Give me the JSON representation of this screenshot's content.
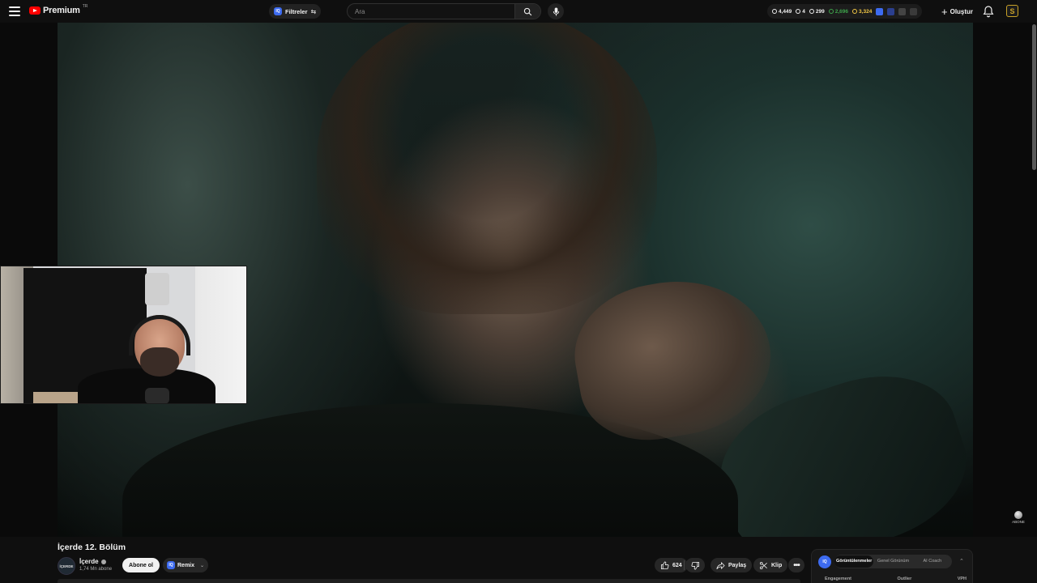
{
  "header": {
    "logo_text": "Premium",
    "logo_region": "TR",
    "filters_label": "Filtreler",
    "filters_badge": "IQ",
    "search_placeholder": "Ara",
    "stats": [
      {
        "icon": "clock-icon",
        "value": "4,449",
        "color": "#ffffff"
      },
      {
        "icon": "eye-icon",
        "value": "4",
        "color": "#ffffff"
      },
      {
        "icon": "view-icon",
        "value": "299",
        "color": "#ffffff"
      },
      {
        "icon": "person-icon",
        "value": "2,696",
        "color": "#3ea34b"
      },
      {
        "icon": "coin-icon",
        "value": "3,324",
        "color": "#f2c744"
      }
    ],
    "create_label": "Oluştur",
    "avatar_letter": "S"
  },
  "video": {
    "title": "İçerde 12. Bölüm"
  },
  "channel": {
    "avatar_text": "İÇERDE",
    "name": "İçerde",
    "subscribers": "1,74 Mn abone",
    "subscribe_label": "Abone ol",
    "remix_label": "Remix",
    "remix_badge": "IQ"
  },
  "actions": {
    "like_count": "624",
    "share_label": "Paylaş",
    "clip_label": "Klip"
  },
  "float_subscribe": {
    "label": "ABONE"
  },
  "iq_panel": {
    "logo": "IQ",
    "tabs": [
      "Görüntülenmeler",
      "Genel Görünüm",
      "AI Coach"
    ],
    "active_tab": 0,
    "columns": [
      "Engagement",
      "Outlier",
      "VPH"
    ]
  },
  "colors": {
    "accent_brand": "#ff0000",
    "iq_blue": "#3d6bf0",
    "background": "#0f0f0f"
  }
}
